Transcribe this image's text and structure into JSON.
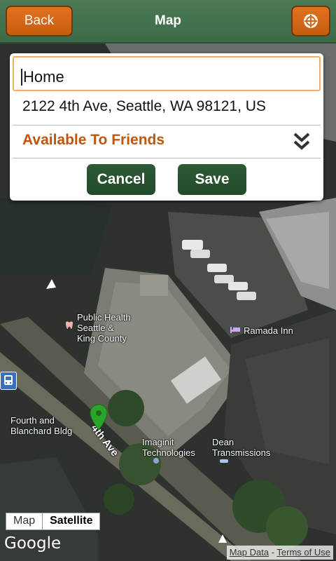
{
  "header": {
    "title": "Map",
    "back_label": "Back",
    "locate_icon": "crosshair-icon"
  },
  "form": {
    "name_value": "Home",
    "address": "2122 4th Ave, Seattle, WA 98121, US",
    "availability": "Available To Friends",
    "availability_icon": "double-chevron-down-icon",
    "cancel_label": "Cancel",
    "save_label": "Save"
  },
  "map": {
    "labels": {
      "public_health": "Public Health\nSeattle &\nKing County",
      "ramada": "Ramada Inn",
      "fourth_blanchard": "Fourth and\nBlanchard Bldg",
      "street": "4th Ave",
      "imaginit": "Imaginit\nTechnologies",
      "dean": "Dean\nTransmissions"
    },
    "toggle_map": "Map",
    "toggle_satellite": "Satellite",
    "logo": "Google",
    "map_data": "Map Data",
    "separator": " - ",
    "terms": "Terms of Use"
  },
  "colors": {
    "header": "#3d6a47",
    "accent_orange": "#d4661a",
    "availability_text": "#c0560a",
    "button_green": "#2e5a36"
  }
}
